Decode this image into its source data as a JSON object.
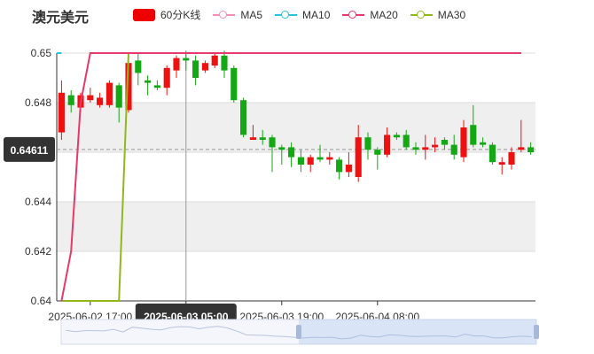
{
  "title": "澳元美元",
  "legend": [
    {
      "name": "60分K线",
      "color": "#ee0000",
      "type": "candle"
    },
    {
      "name": "MA5",
      "color": "#f48fb1",
      "type": "line"
    },
    {
      "name": "MA10",
      "color": "#26c6da",
      "type": "line"
    },
    {
      "name": "MA20",
      "color": "#e6396c",
      "type": "line"
    },
    {
      "name": "MA30",
      "color": "#8fb81d",
      "type": "line"
    }
  ],
  "colors": {
    "up": "#ee1111",
    "down": "#14a814",
    "grid_band": "#efefef"
  },
  "crosshair": {
    "y_value": 0.64611,
    "y_label": "0.64611",
    "x_label": "2025-06-03 05:00"
  },
  "chart_data": {
    "type": "candlestick",
    "ylim": [
      0.64,
      0.65
    ],
    "y_ticks": [
      "0.64",
      "0.642",
      "0.644",
      "0.646",
      "0.648",
      "0.65"
    ],
    "x_ticks": [
      {
        "index": 3,
        "label": "2025-06-02 17:00"
      },
      {
        "index": 13,
        "label": "2025-06-03 05:00"
      },
      {
        "index": 23,
        "label": "2025-06-03 19:00"
      },
      {
        "index": 33,
        "label": "2025-06-04 08:00"
      }
    ],
    "candles": [
      [
        0.6468,
        0.6484,
        0.6465,
        0.6489
      ],
      [
        0.6483,
        0.6479,
        0.6476,
        0.6485
      ],
      [
        0.6478,
        0.6483,
        0.6476,
        0.6484
      ],
      [
        0.6481,
        0.6483,
        0.648,
        0.6486
      ],
      [
        0.6479,
        0.6482,
        0.6478,
        0.6484
      ],
      [
        0.6479,
        0.6488,
        0.6478,
        0.6489
      ],
      [
        0.6487,
        0.6478,
        0.6472,
        0.6488
      ],
      [
        0.6477,
        0.6496,
        0.6476,
        0.6499
      ],
      [
        0.6497,
        0.6492,
        0.6487,
        0.65
      ],
      [
        0.6489,
        0.6488,
        0.6483,
        0.6491
      ],
      [
        0.6487,
        0.6486,
        0.6485,
        0.6489
      ],
      [
        0.6486,
        0.6494,
        0.6483,
        0.6495
      ],
      [
        0.6493,
        0.6498,
        0.649,
        0.6499
      ],
      [
        0.6498,
        0.6497,
        0.6493,
        0.6501
      ],
      [
        0.6497,
        0.649,
        0.6487,
        0.6499
      ],
      [
        0.6493,
        0.6496,
        0.6492,
        0.6497
      ],
      [
        0.6495,
        0.6499,
        0.6494,
        0.65
      ],
      [
        0.6499,
        0.6493,
        0.649,
        0.6501
      ],
      [
        0.6494,
        0.6481,
        0.648,
        0.6495
      ],
      [
        0.6481,
        0.6467,
        0.6466,
        0.6482
      ],
      [
        0.6465,
        0.6466,
        0.6465,
        0.6471
      ],
      [
        0.6466,
        0.6465,
        0.6463,
        0.6469
      ],
      [
        0.6466,
        0.6462,
        0.6452,
        0.6467
      ],
      [
        0.6462,
        0.6461,
        0.6455,
        0.6463
      ],
      [
        0.6462,
        0.6458,
        0.6454,
        0.6464
      ],
      [
        0.6458,
        0.6455,
        0.6452,
        0.6461
      ],
      [
        0.6455,
        0.6458,
        0.6452,
        0.6459
      ],
      [
        0.6458,
        0.6457,
        0.6456,
        0.6463
      ],
      [
        0.6457,
        0.6458,
        0.6455,
        0.646
      ],
      [
        0.6457,
        0.6452,
        0.6449,
        0.6458
      ],
      [
        0.6452,
        0.6455,
        0.645,
        0.646
      ],
      [
        0.645,
        0.6466,
        0.6448,
        0.6471
      ],
      [
        0.6466,
        0.6461,
        0.6457,
        0.6468
      ],
      [
        0.6461,
        0.6459,
        0.6453,
        0.6462
      ],
      [
        0.6459,
        0.6467,
        0.6458,
        0.647
      ],
      [
        0.6467,
        0.6466,
        0.6465,
        0.6468
      ],
      [
        0.6467,
        0.6462,
        0.6461,
        0.6469
      ],
      [
        0.6462,
        0.6461,
        0.6459,
        0.6464
      ],
      [
        0.6461,
        0.6462,
        0.6457,
        0.6467
      ],
      [
        0.6462,
        0.6463,
        0.646,
        0.6466
      ],
      [
        0.6465,
        0.6463,
        0.6461,
        0.6466
      ],
      [
        0.6463,
        0.6459,
        0.6457,
        0.6467
      ],
      [
        0.6458,
        0.647,
        0.6456,
        0.6473
      ],
      [
        0.6471,
        0.6463,
        0.6462,
        0.6479
      ],
      [
        0.6464,
        0.6463,
        0.6462,
        0.6466
      ],
      [
        0.6463,
        0.6456,
        0.6455,
        0.6464
      ],
      [
        0.6455,
        0.6456,
        0.6451,
        0.6458
      ],
      [
        0.6455,
        0.646,
        0.6453,
        0.6462
      ],
      [
        0.6461,
        0.6462,
        0.646,
        0.6473
      ],
      [
        0.6462,
        0.646,
        0.6459,
        0.6464
      ]
    ],
    "ma20": [
      [
        0,
        0.64
      ],
      [
        1,
        0.642
      ],
      [
        2,
        0.648
      ],
      [
        3,
        0.65
      ],
      [
        7,
        0.65
      ],
      [
        48,
        0.65
      ]
    ],
    "ma30": [
      [
        0,
        0.64
      ],
      [
        6,
        0.64
      ],
      [
        7,
        0.65
      ],
      [
        48,
        0.65
      ]
    ],
    "ma10_stub": [
      [
        -1,
        0.65
      ],
      [
        0,
        0.65
      ]
    ]
  }
}
